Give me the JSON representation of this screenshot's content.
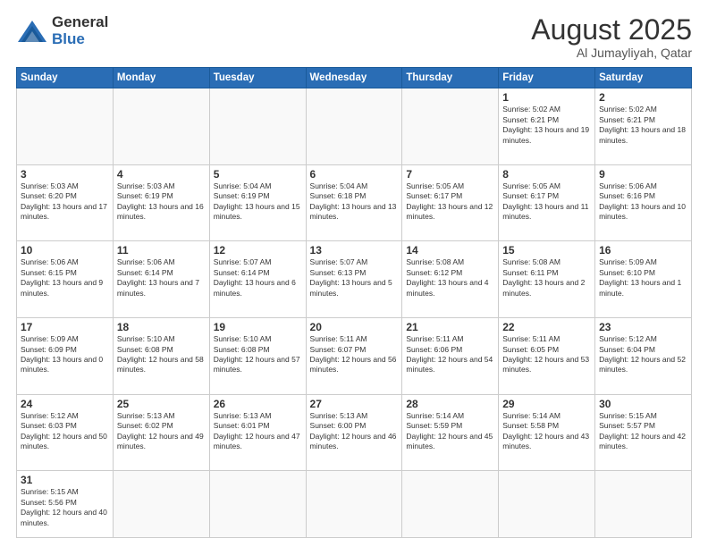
{
  "header": {
    "logo_general": "General",
    "logo_blue": "Blue",
    "month_year": "August 2025",
    "location": "Al Jumayliyah, Qatar"
  },
  "weekdays": [
    "Sunday",
    "Monday",
    "Tuesday",
    "Wednesday",
    "Thursday",
    "Friday",
    "Saturday"
  ],
  "days": {
    "1": {
      "sunrise": "5:02 AM",
      "sunset": "6:21 PM",
      "daylight": "13 hours and 19 minutes."
    },
    "2": {
      "sunrise": "5:02 AM",
      "sunset": "6:21 PM",
      "daylight": "13 hours and 18 minutes."
    },
    "3": {
      "sunrise": "5:03 AM",
      "sunset": "6:20 PM",
      "daylight": "13 hours and 17 minutes."
    },
    "4": {
      "sunrise": "5:03 AM",
      "sunset": "6:19 PM",
      "daylight": "13 hours and 16 minutes."
    },
    "5": {
      "sunrise": "5:04 AM",
      "sunset": "6:19 PM",
      "daylight": "13 hours and 15 minutes."
    },
    "6": {
      "sunrise": "5:04 AM",
      "sunset": "6:18 PM",
      "daylight": "13 hours and 13 minutes."
    },
    "7": {
      "sunrise": "5:05 AM",
      "sunset": "6:17 PM",
      "daylight": "13 hours and 12 minutes."
    },
    "8": {
      "sunrise": "5:05 AM",
      "sunset": "6:17 PM",
      "daylight": "13 hours and 11 minutes."
    },
    "9": {
      "sunrise": "5:06 AM",
      "sunset": "6:16 PM",
      "daylight": "13 hours and 10 minutes."
    },
    "10": {
      "sunrise": "5:06 AM",
      "sunset": "6:15 PM",
      "daylight": "13 hours and 9 minutes."
    },
    "11": {
      "sunrise": "5:06 AM",
      "sunset": "6:14 PM",
      "daylight": "13 hours and 7 minutes."
    },
    "12": {
      "sunrise": "5:07 AM",
      "sunset": "6:14 PM",
      "daylight": "13 hours and 6 minutes."
    },
    "13": {
      "sunrise": "5:07 AM",
      "sunset": "6:13 PM",
      "daylight": "13 hours and 5 minutes."
    },
    "14": {
      "sunrise": "5:08 AM",
      "sunset": "6:12 PM",
      "daylight": "13 hours and 4 minutes."
    },
    "15": {
      "sunrise": "5:08 AM",
      "sunset": "6:11 PM",
      "daylight": "13 hours and 2 minutes."
    },
    "16": {
      "sunrise": "5:09 AM",
      "sunset": "6:10 PM",
      "daylight": "13 hours and 1 minute."
    },
    "17": {
      "sunrise": "5:09 AM",
      "sunset": "6:09 PM",
      "daylight": "13 hours and 0 minutes."
    },
    "18": {
      "sunrise": "5:10 AM",
      "sunset": "6:08 PM",
      "daylight": "12 hours and 58 minutes."
    },
    "19": {
      "sunrise": "5:10 AM",
      "sunset": "6:08 PM",
      "daylight": "12 hours and 57 minutes."
    },
    "20": {
      "sunrise": "5:11 AM",
      "sunset": "6:07 PM",
      "daylight": "12 hours and 56 minutes."
    },
    "21": {
      "sunrise": "5:11 AM",
      "sunset": "6:06 PM",
      "daylight": "12 hours and 54 minutes."
    },
    "22": {
      "sunrise": "5:11 AM",
      "sunset": "6:05 PM",
      "daylight": "12 hours and 53 minutes."
    },
    "23": {
      "sunrise": "5:12 AM",
      "sunset": "6:04 PM",
      "daylight": "12 hours and 52 minutes."
    },
    "24": {
      "sunrise": "5:12 AM",
      "sunset": "6:03 PM",
      "daylight": "12 hours and 50 minutes."
    },
    "25": {
      "sunrise": "5:13 AM",
      "sunset": "6:02 PM",
      "daylight": "12 hours and 49 minutes."
    },
    "26": {
      "sunrise": "5:13 AM",
      "sunset": "6:01 PM",
      "daylight": "12 hours and 47 minutes."
    },
    "27": {
      "sunrise": "5:13 AM",
      "sunset": "6:00 PM",
      "daylight": "12 hours and 46 minutes."
    },
    "28": {
      "sunrise": "5:14 AM",
      "sunset": "5:59 PM",
      "daylight": "12 hours and 45 minutes."
    },
    "29": {
      "sunrise": "5:14 AM",
      "sunset": "5:58 PM",
      "daylight": "12 hours and 43 minutes."
    },
    "30": {
      "sunrise": "5:15 AM",
      "sunset": "5:57 PM",
      "daylight": "12 hours and 42 minutes."
    },
    "31": {
      "sunrise": "5:15 AM",
      "sunset": "5:56 PM",
      "daylight": "12 hours and 40 minutes."
    }
  }
}
